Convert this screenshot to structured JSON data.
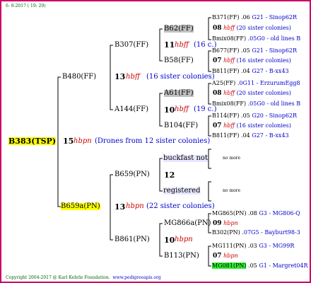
{
  "header": {
    "date": "6-  8-2017 ( 19: 29)"
  },
  "footer": {
    "copyright": "Copyright 2004-2017 @ Karl Kehrle Foundation.",
    "site": "www.pedigreeapis.org"
  },
  "root": {
    "name": "B383(TSP)",
    "num": "15",
    "hb": "hbpn",
    "note": "(Drones from 12 sister colonies)"
  },
  "g1": [
    {
      "name": "B480(FF)",
      "num": "13",
      "hb": "hbff",
      "note": "(16 sister colonies)"
    },
    {
      "name": "B659a(PN)",
      "num": "13",
      "hb": "hbpn",
      "note": "(22 sister colonies)"
    }
  ],
  "g2": [
    {
      "name": "B307(FF)",
      "num": "11",
      "hb": "hbff",
      "note": "(16 c.)"
    },
    {
      "name": "A144(FF)",
      "num": "10",
      "hb": "hbff",
      "note": "(19 c.)"
    },
    {
      "name": "B659(PN)",
      "num": "12",
      "hb": "",
      "note": ""
    },
    {
      "name": "B861(PN)",
      "num": "10",
      "hb": "hbpn",
      "note": ""
    }
  ],
  "g3": [
    {
      "name": "B62(FF)",
      "num": "08",
      "hb": "hbff",
      "note": "(20 sister colonies)"
    },
    {
      "name": "B58(FF)",
      "num": "07",
      "hb": "hbff",
      "note": "(16 sister colonies)"
    },
    {
      "name": "A61(FF)",
      "num": "08",
      "hb": "hbff",
      "note": "(20 sister colonies)"
    },
    {
      "name": "B104(FF)",
      "num": "07",
      "hb": "hbff",
      "note": "(16 sister colonies)"
    },
    {
      "name": "buckfast not",
      "more": "no more"
    },
    {
      "name": "registered",
      "more": "no more"
    },
    {
      "name": "MG866a(PN)",
      "num": "09",
      "hb": "hbpn",
      "note": ""
    },
    {
      "name": "B113(PN)",
      "num": "07",
      "hb": "hbpn",
      "note": ""
    }
  ],
  "g4": [
    {
      "name": "B371(FF)",
      "year": ".06",
      "origin": "G21 - Sinop62R"
    },
    {
      "name": "Bmix08(FF)",
      "year": ".05G0",
      "origin": "- old lines B"
    },
    {
      "name": "B677(FF)",
      "year": ".05",
      "origin": "G21 - Sinop62R"
    },
    {
      "name": "B811(FF)",
      "year": ".04",
      "origin": "G27 - B-xx43"
    },
    {
      "name": "A25(FF)",
      "year": ".0G11",
      "origin": "- ErzurumEgg8"
    },
    {
      "name": "Bmix08(FF)",
      "year": ".05G0",
      "origin": "- old lines B"
    },
    {
      "name": "B114(FF)",
      "year": ".05",
      "origin": "G20 - Sinop62R"
    },
    {
      "name": "B811(FF)",
      "year": ".04",
      "origin": "G27 - B-xx43"
    },
    {
      "name": "MG865(PN)",
      "year": ".08",
      "origin": "G3 - MG806-Q"
    },
    {
      "name": "B302(PN)",
      "year": ".07G5",
      "origin": "- Bayburt98-3"
    },
    {
      "name": "MG111(PN)",
      "year": ".03",
      "origin": "G3 - MG99R"
    },
    {
      "name": "MG081(PN)",
      "year": ".05",
      "origin": "G1 - Margret04R"
    }
  ]
}
